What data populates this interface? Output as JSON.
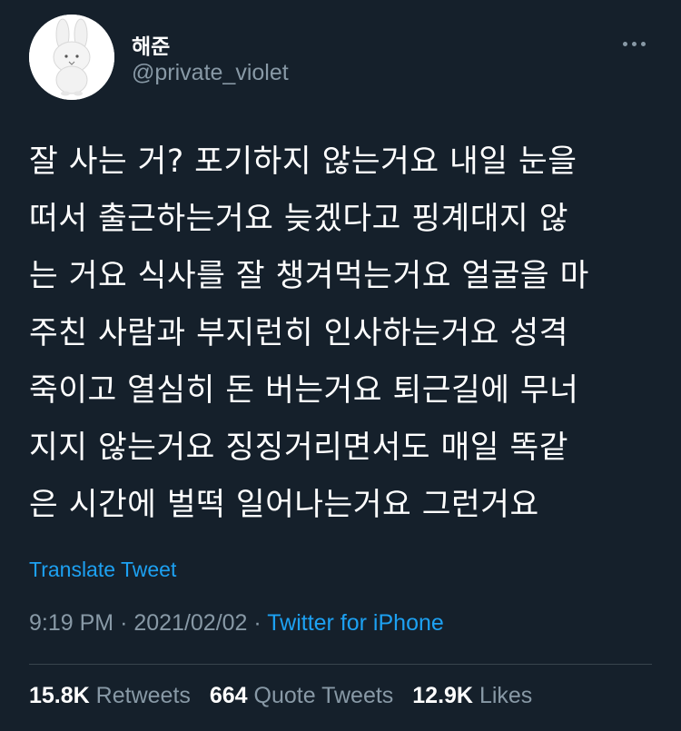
{
  "author": {
    "display_name": "해준",
    "handle": "@private_violet"
  },
  "tweet": {
    "lines": [
      "잘 사는 거? 포기하지 않는거요 내일 눈을",
      "떠서 출근하는거요 늦겠다고 핑계대지 않",
      "는 거요 식사를 잘 챙겨먹는거요 얼굴을 마",
      "주친 사람과 부지런히 인사하는거요 성격",
      "죽이고 열심히 돈 버는거요 퇴근길에 무너",
      "지지 않는거요 징징거리면서도 매일 똑같",
      "은 시간에 벌떡 일어나는거요 그런거요"
    ],
    "translate_label": "Translate Tweet",
    "time": "9:19 PM",
    "date": "2021/02/02",
    "separator": "·",
    "source": "Twitter for iPhone"
  },
  "stats": {
    "retweets_count": "15.8K",
    "retweets_label": "Retweets",
    "quotes_count": "664",
    "quotes_label": "Quote Tweets",
    "likes_count": "12.9K",
    "likes_label": "Likes"
  },
  "icons": {
    "more": "more-dots-icon",
    "avatar": "bunny-avatar"
  },
  "colors": {
    "background": "#15202b",
    "text": "#ffffff",
    "secondary_text": "#8899a6",
    "link": "#1da1f2",
    "divider": "#38444d"
  }
}
